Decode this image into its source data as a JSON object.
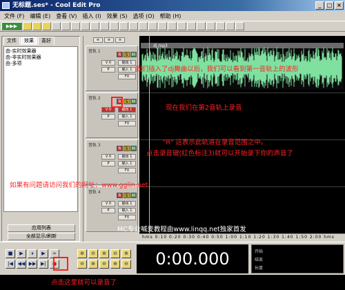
{
  "window": {
    "title": "无标题.ses* - Cool Edit Pro",
    "minimize": "_",
    "maximize": "□",
    "close": "×"
  },
  "menu": [
    "文件 (F)",
    "编辑 (E)",
    "查看 (V)",
    "插入 (I)",
    "效果 (S)",
    "选项 (O)",
    "帮助 (H)"
  ],
  "left_panel": {
    "tabs": [
      "文件",
      "效果",
      "喜好"
    ],
    "tree": [
      "由-实时效果器",
      "由-非实时效果器",
      "由-多项"
    ],
    "buttons": [
      "应用列表",
      "全部显示/刷新"
    ]
  },
  "tracks": [
    {
      "name": "音轨 1",
      "vol": "V 0",
      "ctl1": "输出 1",
      "ctl2": "输入 1"
    },
    {
      "name": "音轨 2",
      "vol": "V 0",
      "ctl1": "输出 1",
      "ctl2": "输入 1"
    },
    {
      "name": "音轨 3",
      "vol": "V 0",
      "ctl1": "输出 1",
      "ctl2": "输入 1"
    },
    {
      "name": "音轨 4",
      "vol": "V 0",
      "ctl1": "输出 1",
      "ctl2": "输入 1"
    }
  ],
  "track_buttons": {
    "record": "R",
    "solo": "S",
    "mute": "M"
  },
  "clip_label": "dj.mp3",
  "ruler_text": "hms 0:10 0:20 0:30 0:40 0:50 1:00 1:10 1:20 1:30 1:40 1:50 2:00 hms",
  "transport": {
    "row1": [
      "■",
      "▶",
      "⏸",
      "▶",
      "∞"
    ],
    "row2": [
      "|◀",
      "◀◀",
      "▶▶",
      "▶|",
      "●"
    ]
  },
  "zoom_buttons": [
    "⊕",
    "⊖",
    "⊕",
    "⊖",
    "⊕",
    "⊖",
    "⊕",
    "⊖",
    "⊕",
    "⊖"
  ],
  "time_display": "0:00.000",
  "info_panel": {
    "begin": "开始",
    "end": "结束",
    "length": "长度"
  },
  "annotations": [
    {
      "id": "ann-wave",
      "text": "我们插入了dj舞曲以后，我们可以看到第一音轨上的波形",
      "color": "red"
    },
    {
      "id": "ann-track2",
      "text": "现在我们在第2音轨上录音",
      "color": "red"
    },
    {
      "id": "ann-r1",
      "text": "\"R\" 这表示此轨道在录音范围之中。",
      "color": "red"
    },
    {
      "id": "ann-r2",
      "text": "点击录音键(红色标注3)就可以开始录下你的声音了",
      "color": "red"
    },
    {
      "id": "ann-url",
      "text": "如果有问题请访问我们的网址：www.gglin.net",
      "color": "red"
    },
    {
      "id": "ann-mc",
      "text": "MC专业喊麦教程由www.linqq.net独家首发",
      "color": "white"
    },
    {
      "id": "ann-bottom",
      "text": "点击这里就可以录音了",
      "color": "red"
    }
  ],
  "colors": {
    "waveform": "#7fe0a0",
    "annotation_red": "#ff2222",
    "record_button": "#c03030"
  }
}
